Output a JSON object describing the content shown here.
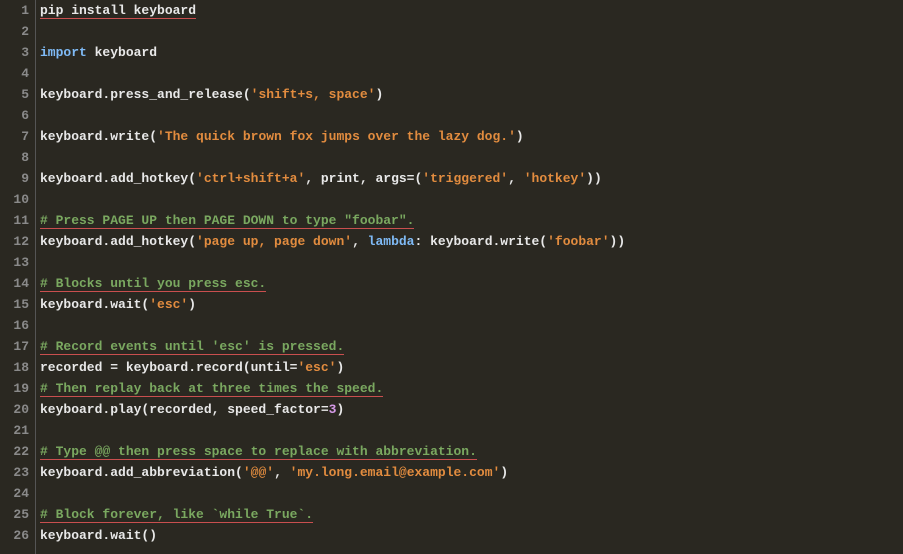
{
  "lines": [
    {
      "num": "1",
      "tokens": [
        {
          "t": "plain",
          "v": "pip install keyboard",
          "u": true
        }
      ]
    },
    {
      "num": "2",
      "tokens": []
    },
    {
      "num": "3",
      "tokens": [
        {
          "t": "kw",
          "v": "import"
        },
        {
          "t": "plain",
          "v": " keyboard"
        }
      ]
    },
    {
      "num": "4",
      "tokens": []
    },
    {
      "num": "5",
      "tokens": [
        {
          "t": "plain",
          "v": "keyboard.press_and_release("
        },
        {
          "t": "str",
          "v": "'shift+s, space'"
        },
        {
          "t": "plain",
          "v": ")"
        }
      ]
    },
    {
      "num": "6",
      "tokens": []
    },
    {
      "num": "7",
      "tokens": [
        {
          "t": "plain",
          "v": "keyboard.write("
        },
        {
          "t": "str",
          "v": "'The quick brown fox jumps over the lazy dog.'"
        },
        {
          "t": "plain",
          "v": ")"
        }
      ]
    },
    {
      "num": "8",
      "tokens": []
    },
    {
      "num": "9",
      "tokens": [
        {
          "t": "plain",
          "v": "keyboard.add_hotkey("
        },
        {
          "t": "str",
          "v": "'ctrl+shift+a'"
        },
        {
          "t": "plain",
          "v": ", print, args=("
        },
        {
          "t": "str",
          "v": "'triggered'"
        },
        {
          "t": "plain",
          "v": ", "
        },
        {
          "t": "str",
          "v": "'hotkey'"
        },
        {
          "t": "plain",
          "v": "))"
        }
      ]
    },
    {
      "num": "10",
      "tokens": []
    },
    {
      "num": "11",
      "tokens": [
        {
          "t": "comment",
          "v": "# Press PAGE UP then PAGE DOWN to type \"foobar\".",
          "u": true
        }
      ]
    },
    {
      "num": "12",
      "tokens": [
        {
          "t": "plain",
          "v": "keyboard.add_hotkey("
        },
        {
          "t": "str",
          "v": "'page up, page down'"
        },
        {
          "t": "plain",
          "v": ", "
        },
        {
          "t": "kw",
          "v": "lambda"
        },
        {
          "t": "plain",
          "v": ": keyboard.write("
        },
        {
          "t": "str",
          "v": "'foobar'"
        },
        {
          "t": "plain",
          "v": "))"
        }
      ]
    },
    {
      "num": "13",
      "tokens": []
    },
    {
      "num": "14",
      "tokens": [
        {
          "t": "comment",
          "v": "# Blocks until you press esc.",
          "u": true
        }
      ]
    },
    {
      "num": "15",
      "tokens": [
        {
          "t": "plain",
          "v": "keyboard.wait("
        },
        {
          "t": "str",
          "v": "'esc'"
        },
        {
          "t": "plain",
          "v": ")"
        }
      ]
    },
    {
      "num": "16",
      "tokens": []
    },
    {
      "num": "17",
      "tokens": [
        {
          "t": "comment",
          "v": "# Record events until 'esc' is pressed.",
          "u": true
        }
      ]
    },
    {
      "num": "18",
      "tokens": [
        {
          "t": "plain",
          "v": "recorded = keyboard.record(until="
        },
        {
          "t": "str",
          "v": "'esc'"
        },
        {
          "t": "plain",
          "v": ")"
        }
      ]
    },
    {
      "num": "19",
      "tokens": [
        {
          "t": "comment",
          "v": "# Then replay back at three times the speed.",
          "u": true
        }
      ]
    },
    {
      "num": "20",
      "tokens": [
        {
          "t": "plain",
          "v": "keyboard.play(recorded, speed_factor="
        },
        {
          "t": "num",
          "v": "3"
        },
        {
          "t": "plain",
          "v": ")"
        }
      ]
    },
    {
      "num": "21",
      "tokens": []
    },
    {
      "num": "22",
      "tokens": [
        {
          "t": "comment",
          "v": "# Type @@ then press space to replace with abbreviation.",
          "u": true
        }
      ]
    },
    {
      "num": "23",
      "tokens": [
        {
          "t": "plain",
          "v": "keyboard.add_abbreviation("
        },
        {
          "t": "str",
          "v": "'@@'"
        },
        {
          "t": "plain",
          "v": ", "
        },
        {
          "t": "str",
          "v": "'my.long.email@example.com'"
        },
        {
          "t": "plain",
          "v": ")"
        }
      ]
    },
    {
      "num": "24",
      "tokens": []
    },
    {
      "num": "25",
      "tokens": [
        {
          "t": "comment",
          "v": "# Block forever, like `while True`.",
          "u": true
        }
      ]
    },
    {
      "num": "26",
      "tokens": [
        {
          "t": "plain",
          "v": "keyboard.wait()"
        }
      ]
    }
  ]
}
